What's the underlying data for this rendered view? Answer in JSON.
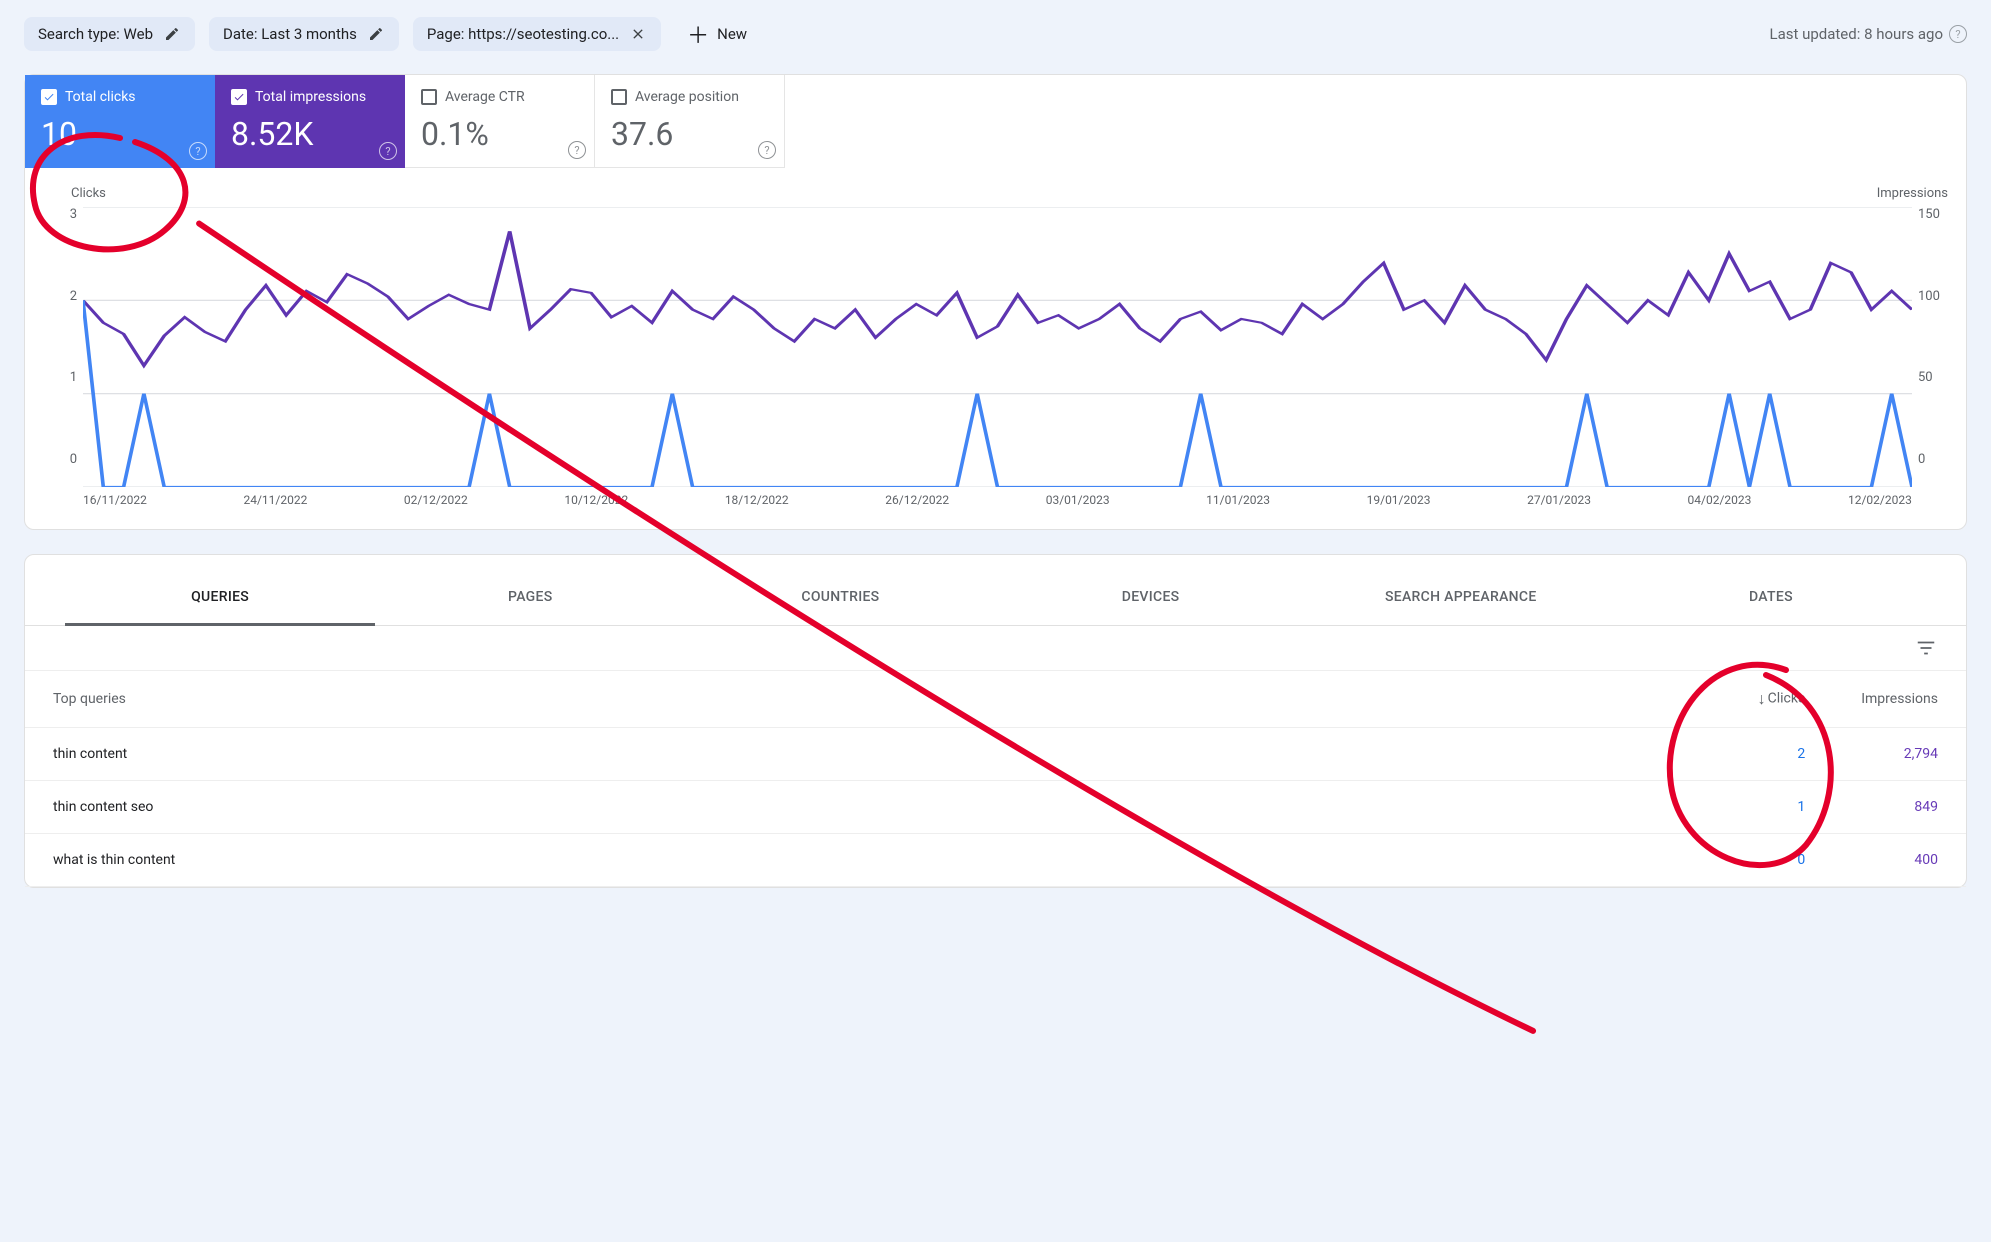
{
  "filters": {
    "search_type": "Search type: Web",
    "date": "Date: Last 3 months",
    "page": "Page: https://seotesting.co...",
    "new_label": "New"
  },
  "last_updated": "Last updated: 8 hours ago",
  "metrics": {
    "clicks_label": "Total clicks",
    "clicks_value": "10",
    "impressions_label": "Total impressions",
    "impressions_value": "8.52K",
    "ctr_label": "Average CTR",
    "ctr_value": "0.1%",
    "position_label": "Average position",
    "position_value": "37.6"
  },
  "chart_labels": {
    "left": "Clicks",
    "right": "Impressions"
  },
  "tabs": [
    "QUERIES",
    "PAGES",
    "COUNTRIES",
    "DEVICES",
    "SEARCH APPEARANCE",
    "DATES"
  ],
  "table": {
    "header_query": "Top queries",
    "header_clicks": "Clicks",
    "header_impressions": "Impressions",
    "rows": [
      {
        "query": "thin content",
        "clicks": "2",
        "impressions": "2,794"
      },
      {
        "query": "thin content seo",
        "clicks": "1",
        "impressions": "849"
      },
      {
        "query": "what is thin content",
        "clicks": "0",
        "impressions": "400"
      }
    ]
  },
  "chart_data": {
    "type": "line",
    "xlabel": "",
    "x_ticks": [
      "16/11/2022",
      "24/11/2022",
      "02/12/2022",
      "10/12/2022",
      "18/12/2022",
      "26/12/2022",
      "03/01/2023",
      "11/01/2023",
      "19/01/2023",
      "27/01/2023",
      "04/02/2023",
      "12/02/2023"
    ],
    "series": [
      {
        "name": "Clicks",
        "ylabel": "Clicks",
        "ylim": [
          0,
          3
        ],
        "y_ticks": [
          0,
          1,
          2,
          3
        ],
        "color": "#4285f4",
        "values": [
          2,
          0,
          0,
          1,
          0,
          0,
          0,
          0,
          0,
          0,
          0,
          0,
          0,
          0,
          0,
          0,
          0,
          0,
          0,
          0,
          1,
          0,
          0,
          0,
          0,
          0,
          0,
          0,
          0,
          1,
          0,
          0,
          0,
          0,
          0,
          0,
          0,
          0,
          0,
          0,
          0,
          0,
          0,
          0,
          1,
          0,
          0,
          0,
          0,
          0,
          0,
          0,
          0,
          0,
          0,
          1,
          0,
          0,
          0,
          0,
          0,
          0,
          0,
          0,
          0,
          0,
          0,
          0,
          0,
          0,
          0,
          0,
          0,
          0,
          1,
          0,
          0,
          0,
          0,
          0,
          0,
          1,
          0,
          1,
          0,
          0,
          0,
          0,
          0,
          1,
          0
        ]
      },
      {
        "name": "Impressions",
        "ylabel": "Impressions",
        "ylim": [
          0,
          150
        ],
        "y_ticks": [
          0,
          50,
          100,
          150
        ],
        "color": "#5e35b1",
        "values": [
          100,
          88,
          82,
          65,
          81,
          91,
          83,
          78,
          95,
          108,
          92,
          105,
          99,
          114,
          109,
          102,
          90,
          97,
          103,
          98,
          95,
          137,
          85,
          95,
          106,
          104,
          91,
          97,
          88,
          105,
          95,
          90,
          102,
          95,
          85,
          78,
          90,
          85,
          95,
          80,
          90,
          98,
          92,
          104,
          80,
          86,
          103,
          88,
          92,
          85,
          90,
          98,
          85,
          78,
          90,
          94,
          84,
          90,
          88,
          82,
          98,
          90,
          98,
          110,
          120,
          95,
          100,
          88,
          108,
          95,
          90,
          82,
          68,
          90,
          108,
          98,
          88,
          100,
          92,
          115,
          100,
          125,
          105,
          110,
          90,
          95,
          120,
          115,
          95,
          105,
          95
        ]
      }
    ]
  }
}
